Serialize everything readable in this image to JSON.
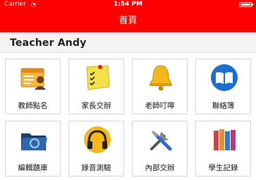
{
  "status_bar": {
    "carrier": "Carrier",
    "time": "1:54 PM"
  },
  "nav": {
    "title": "首頁"
  },
  "section": {
    "title": "Teacher Andy"
  },
  "tiles": [
    {
      "label": "教師點名",
      "icon": "roll-call-icon"
    },
    {
      "label": "家長交辦",
      "icon": "sticky-note-icon"
    },
    {
      "label": "老師叮嚀",
      "icon": "bell-icon"
    },
    {
      "label": "聯絡簿",
      "icon": "book-icon"
    },
    {
      "label": "編輯題庫",
      "icon": "folder-icon"
    },
    {
      "label": "錄音測驗",
      "icon": "headphones-icon"
    },
    {
      "label": "內部交辦",
      "icon": "tools-icon"
    },
    {
      "label": "學生記錄",
      "icon": "books-icon"
    }
  ],
  "colors": {
    "accent": "#ff0000",
    "header_bg": "#f3f3f3",
    "border": "#d8d8d8"
  }
}
